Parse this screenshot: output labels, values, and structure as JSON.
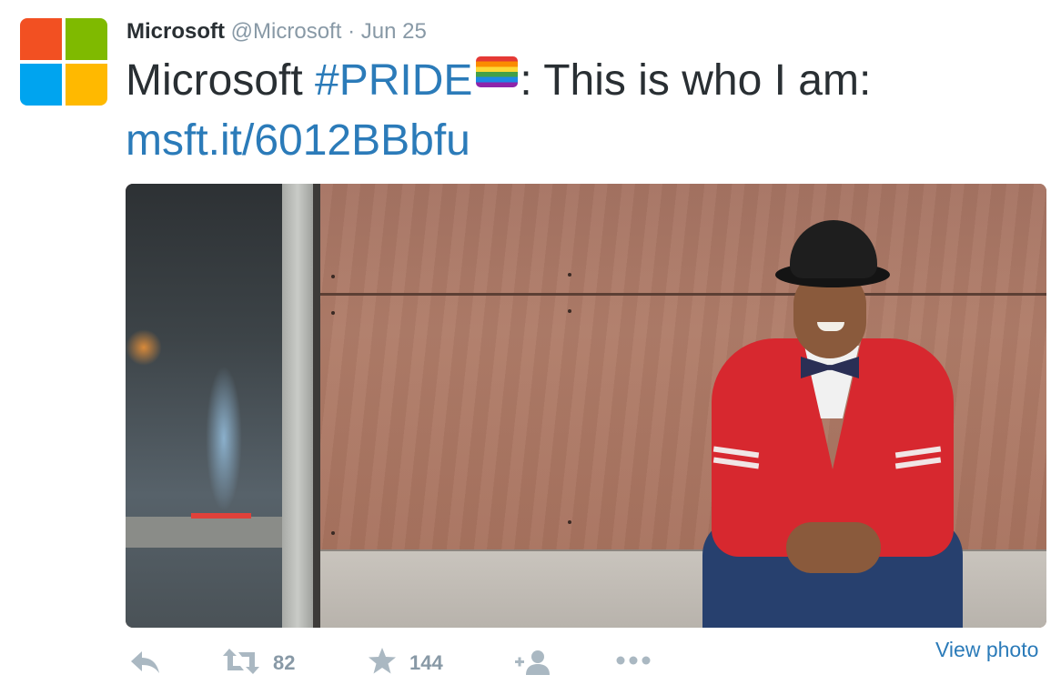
{
  "tweet": {
    "author": {
      "display_name": "Microsoft",
      "handle": "@Microsoft",
      "separator": "·",
      "date": "Jun 25",
      "avatar_icon": "microsoft-logo",
      "avatar_colors": [
        "#f25022",
        "#7fba00",
        "#00a4ef",
        "#ffb900"
      ]
    },
    "text": {
      "prefix": "Microsoft ",
      "hashtag": "#PRIDE",
      "emoji": "rainbow-flag-icon",
      "suffix": ": This is who I am:",
      "link": "msft.it/6012BBbfu"
    },
    "media": {
      "type": "photo",
      "icon": "photo"
    },
    "actions": {
      "reply_icon": "reply-icon",
      "retweet_icon": "retweet-icon",
      "retweet_count": "82",
      "favorite_icon": "star-icon",
      "favorite_count": "144",
      "follow_icon": "add-user-icon",
      "more_icon": "more-icon",
      "view_photo_label": "View photo"
    },
    "colors": {
      "text": "#292f33",
      "meta": "#8899a6",
      "link": "#2b7bb9",
      "action_icon": "#aab8c2"
    }
  }
}
